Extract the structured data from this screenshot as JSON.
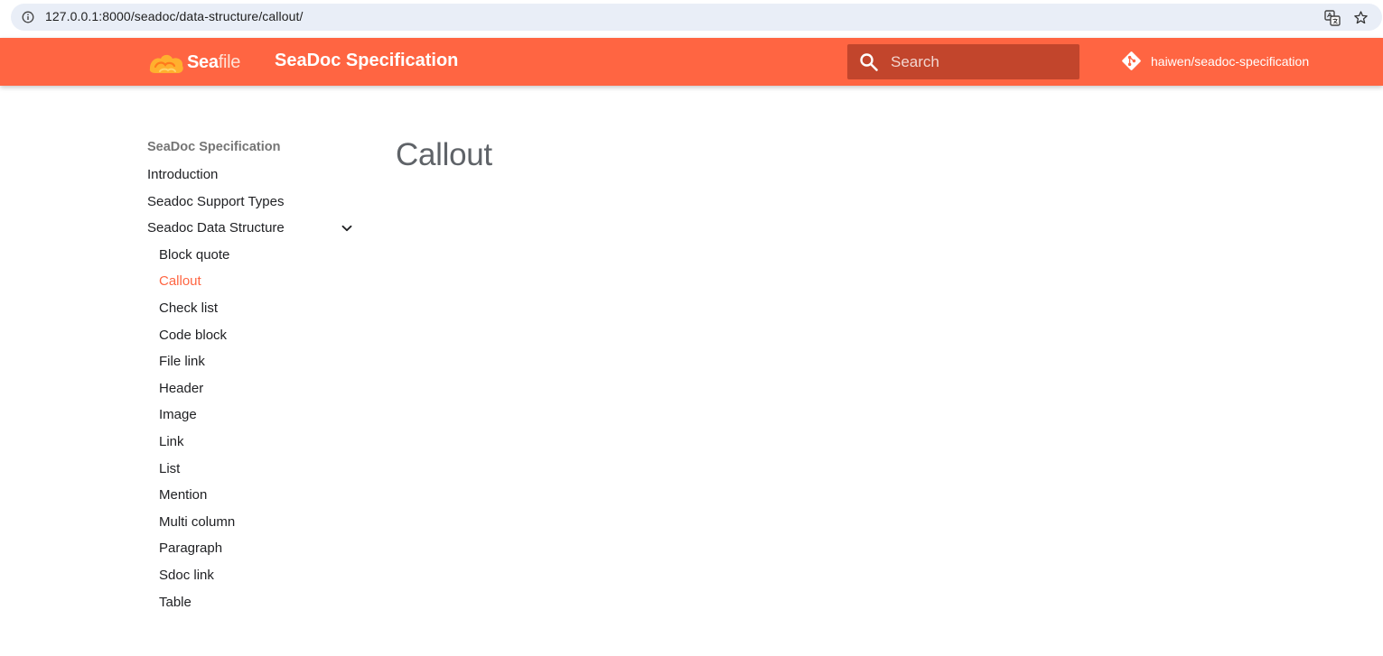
{
  "browser": {
    "url": "127.0.0.1:8000/seadoc/data-structure/callout/",
    "info_icon": "info-circle-icon",
    "translate_icon": "translate-icon",
    "bookmark_icon": "star-icon"
  },
  "header": {
    "logo_text_a": "Sea",
    "logo_text_b": "file",
    "title": "SeaDoc Specification",
    "search": {
      "placeholder": "Search",
      "value": ""
    },
    "repo": "haiwen/seadoc-specification",
    "colors": {
      "brand": "#ff6542",
      "search_bg": "#c2452c"
    }
  },
  "sidebar": {
    "heading": "SeaDoc Specification",
    "items": [
      {
        "label": "Introduction"
      },
      {
        "label": "Seadoc Support Types"
      },
      {
        "label": "Seadoc Data Structure",
        "expanded": true
      }
    ],
    "subitems": [
      {
        "label": "Block quote"
      },
      {
        "label": "Callout",
        "active": true
      },
      {
        "label": "Check list"
      },
      {
        "label": "Code block"
      },
      {
        "label": "File link"
      },
      {
        "label": "Header"
      },
      {
        "label": "Image"
      },
      {
        "label": "Link"
      },
      {
        "label": "List"
      },
      {
        "label": "Mention"
      },
      {
        "label": "Multi column"
      },
      {
        "label": "Paragraph"
      },
      {
        "label": "Sdoc link"
      },
      {
        "label": "Table"
      }
    ]
  },
  "main": {
    "title": "Callout"
  }
}
